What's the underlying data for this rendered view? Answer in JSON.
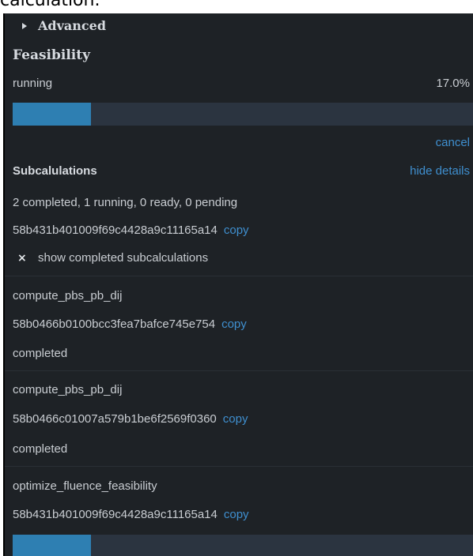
{
  "caption": "calculation.",
  "advanced": {
    "label": "Advanced"
  },
  "feasibility": {
    "title": "Feasibility",
    "status": "running",
    "percent_label": "17.0%",
    "progress": 0.17,
    "cancel_label": "cancel"
  },
  "subcalculations": {
    "title": "Subcalulations",
    "hide_label": "hide details",
    "summary": "2 completed, 1 running, 0 ready, 0 pending",
    "id": "58b431b401009f69c4428a9c11165a14",
    "copy_label": "copy",
    "show_completed": {
      "checked": true,
      "mark": "×",
      "label": "show completed subcalculations"
    },
    "items": [
      {
        "name": "compute_pbs_pb_dij",
        "id": "58b0466b0100bcc3fea7bafce745e754",
        "copy": "copy",
        "status": "completed"
      },
      {
        "name": "compute_pbs_pb_dij",
        "id": "58b0466c01007a579b1be6f2569f0360",
        "copy": "copy",
        "status": "completed"
      },
      {
        "name": "optimize_fluence_feasibility",
        "id": "58b431b401009f69c4428a9c11165a14",
        "copy": "copy",
        "progress": 0.17
      }
    ]
  },
  "colors": {
    "background": "#1e2226",
    "text": "#c9cdd2",
    "link": "#3f8fcf",
    "progress_fill": "#2e7fb2",
    "progress_track": "#2b3440"
  }
}
